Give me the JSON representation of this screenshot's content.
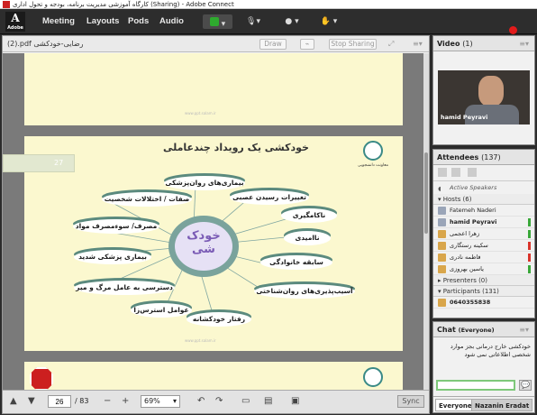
{
  "window": {
    "title": "کارگاه آموزشی مدیریت برنامه، بودجه و تحول اداری (Sharing) - Adobe Connect"
  },
  "menubar": {
    "logo_text": "A",
    "logo_sub": "Adobe",
    "items": [
      "Meeting",
      "Layouts",
      "Pods",
      "Audio"
    ]
  },
  "share_pod": {
    "filename": "(2).pdf رضایی-خودکشی",
    "draw_label": "Draw",
    "stop_sharing_label": "Stop Sharing",
    "current_page": "26",
    "total_pages": "/ 83",
    "zoom": "69%",
    "sync_label": "Sync"
  },
  "slide": {
    "title": "خودکشی یک رویداد چندعاملی",
    "page_number": "27",
    "center": "خودک شی",
    "logo_caption": "معاونت دانشجویی",
    "watermark": "www.ppt.salam.ir",
    "bubbles": [
      "بیماری‌های روان‌پزشکی",
      "تغییرات رسیدن عصبی",
      "صفات / اختلالات شخصیت",
      "ناکامگیری",
      "مصرف/ سوءمصرف مواد",
      "ناامیدی",
      "بیماری پزشکی شدید",
      "سابقه خانوادگی",
      "دسترسی به عامل مرگ و میر",
      "آسیب‌پذیری‌های روان‌شناختی",
      "عوامل استرس‌زا",
      "رفتار خودکشانه"
    ]
  },
  "video_pod": {
    "title": "Video",
    "count": "(1)",
    "presenter_name": "hamid Peyravi"
  },
  "attendees_pod": {
    "title": "Attendees",
    "count": "(137)",
    "active_speakers": "Active Speakers",
    "hosts_label": "Hosts (6)",
    "hosts": [
      "Fatemeh Naderi",
      "hamid Peyravi",
      "زهرا اعجمی",
      "سکینه رستگاری",
      "فاطمه نادری",
      "یاسین بهروزی"
    ],
    "presenters_label": "Presenters (0)",
    "participants_label": "Participants (131)",
    "participants": [
      "0640355838"
    ],
    "colors": {
      "online": "#3aa83a",
      "busy": "#d9342b"
    }
  },
  "chat_pod": {
    "title": "Chat",
    "scope": "(Everyone)",
    "message": "خودکشی خارج درمانی بجز موارد شخصی اطلاعاتی نمی شود",
    "tabs": [
      "Everyone",
      "Nazanin Eradat"
    ]
  }
}
